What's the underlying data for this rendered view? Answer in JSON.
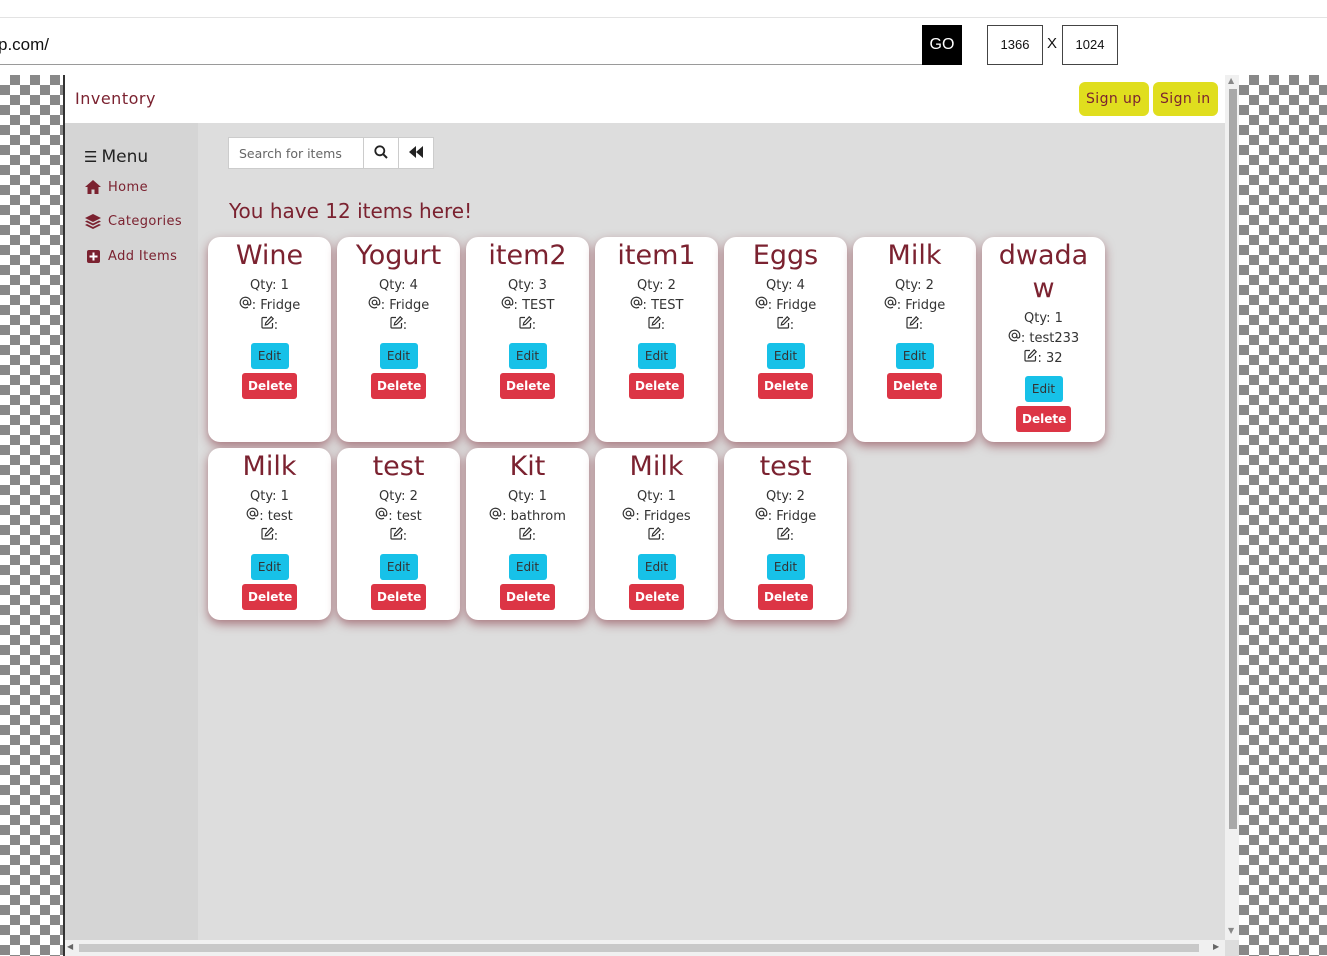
{
  "resizer": {
    "url": "p.com/",
    "go_label": "GO",
    "width": "1366",
    "separator": "X",
    "height": "1024"
  },
  "navbar": {
    "brand": "Inventory",
    "signup_label": "Sign up",
    "signin_label": "Sign in",
    "button_color": "#e0de1e"
  },
  "sidebar": {
    "menu_label": "Menu",
    "items": [
      {
        "label": "Home",
        "icon": "home-icon"
      },
      {
        "label": "Categories",
        "icon": "layers-icon"
      },
      {
        "label": "Add Items",
        "icon": "plus-square-icon"
      }
    ]
  },
  "search": {
    "placeholder": "Search for items"
  },
  "heading": "You have 12 items here!",
  "colors": {
    "accent": "#7b2230",
    "edit": "#17c1e8",
    "delete": "#dc3545"
  },
  "labels": {
    "qty_prefix": "Qty:",
    "location_prefix": ":",
    "note_prefix": ":",
    "edit": "Edit",
    "delete": "Delete"
  },
  "items": [
    {
      "name": "Wine",
      "qty": "1",
      "location": "Fridge",
      "note": ""
    },
    {
      "name": "Yogurt",
      "qty": "4",
      "location": "Fridge",
      "note": ""
    },
    {
      "name": "item2",
      "qty": "3",
      "location": "TEST",
      "note": ""
    },
    {
      "name": "item1",
      "qty": "2",
      "location": "TEST",
      "note": ""
    },
    {
      "name": "Eggs",
      "qty": "4",
      "location": "Fridge",
      "note": ""
    },
    {
      "name": "Milk",
      "qty": "2",
      "location": "Fridge",
      "note": ""
    },
    {
      "name": "dwadaw",
      "qty": "1",
      "location": "test233",
      "note": "32"
    },
    {
      "name": "Milk",
      "qty": "1",
      "location": "test",
      "note": ""
    },
    {
      "name": "test",
      "qty": "2",
      "location": "test",
      "note": ""
    },
    {
      "name": "Kit",
      "qty": "1",
      "location": "bathrom",
      "note": ""
    },
    {
      "name": "Milk",
      "qty": "1",
      "location": "Fridges",
      "note": ""
    },
    {
      "name": "test",
      "qty": "2",
      "location": "Fridge",
      "note": ""
    }
  ]
}
